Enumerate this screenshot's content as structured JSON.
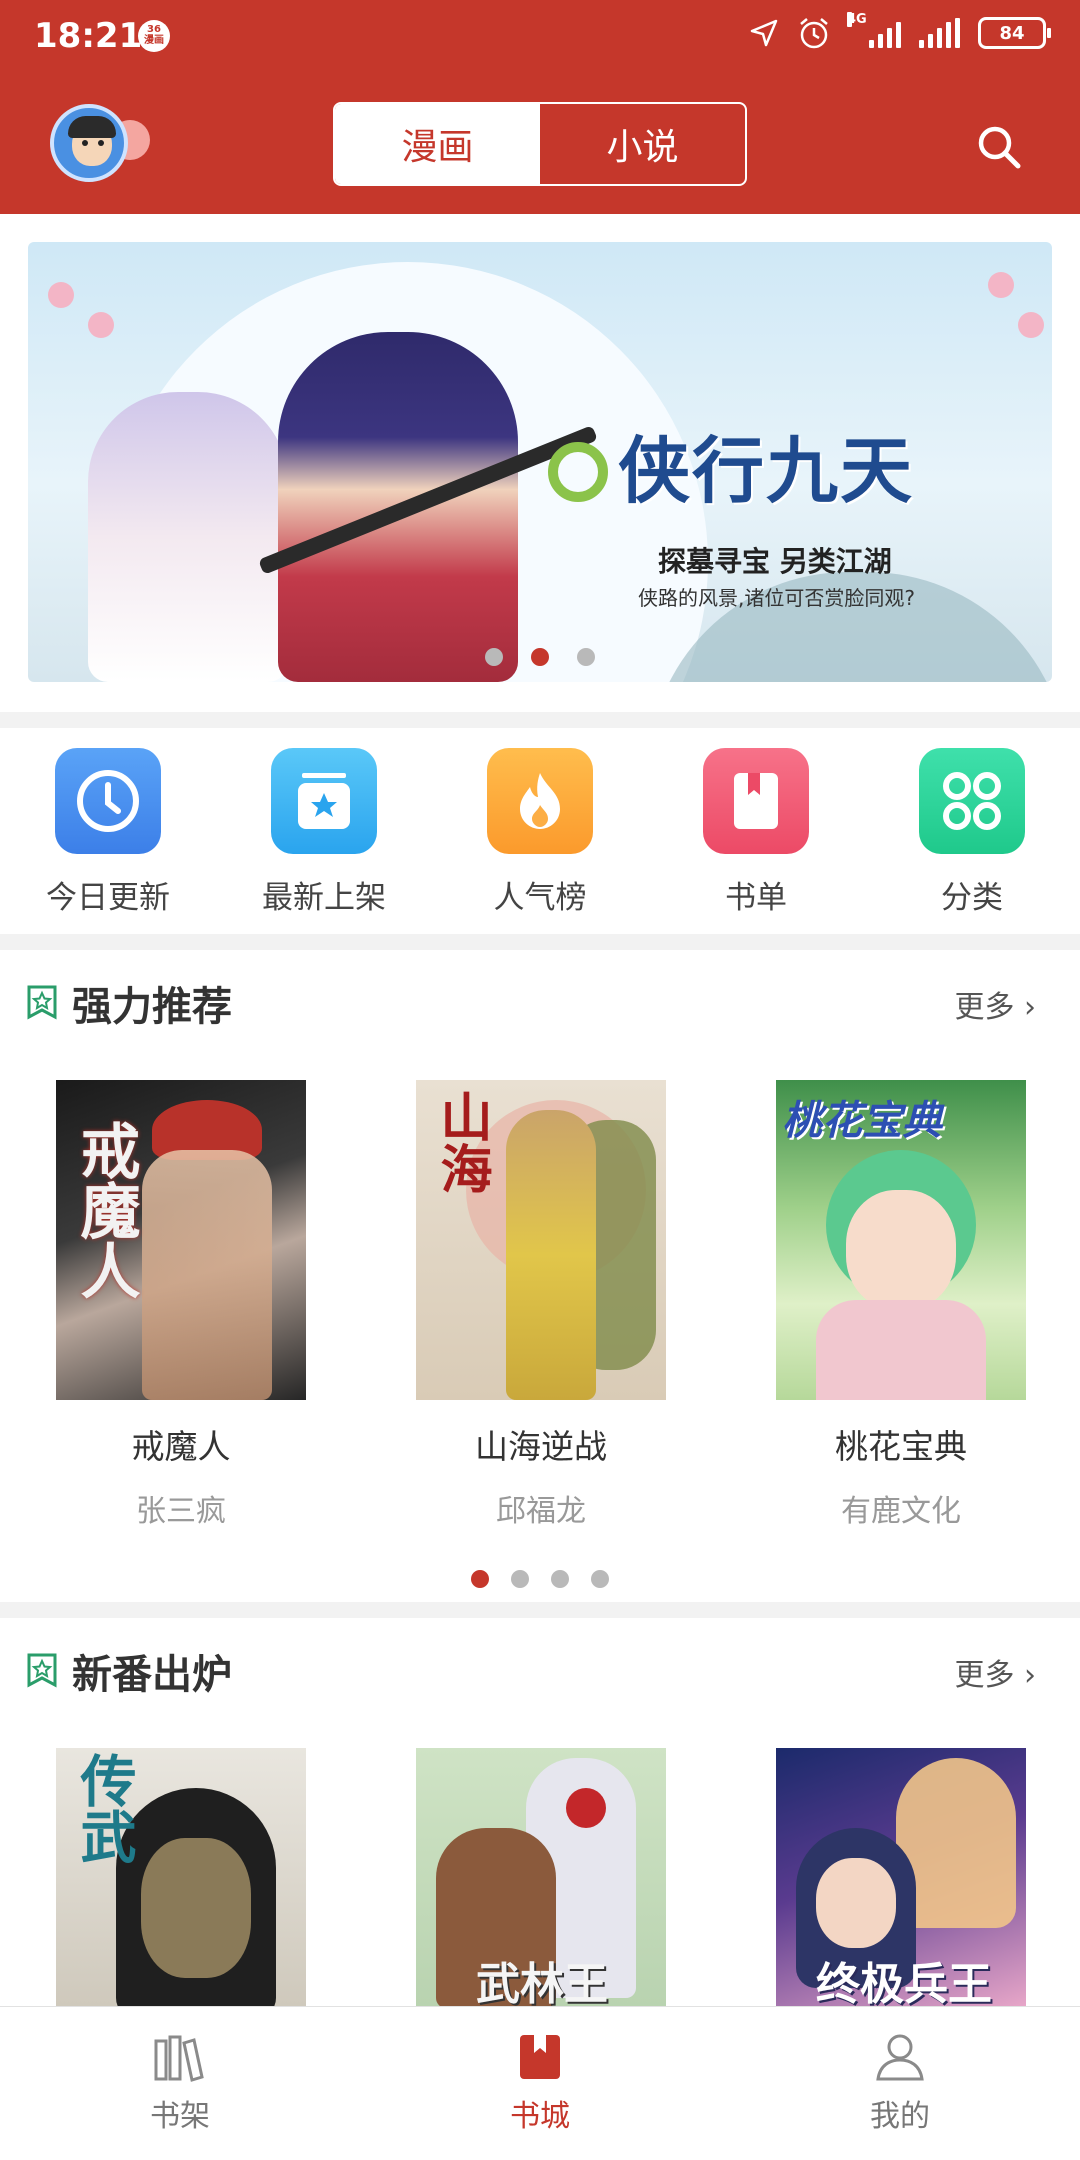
{
  "status_bar": {
    "time": "18:21",
    "app_badge": "36漫画",
    "network": "4G",
    "battery": "84"
  },
  "header": {
    "tabs": [
      {
        "label": "漫画",
        "active": true
      },
      {
        "label": "小说",
        "active": false
      }
    ],
    "accent": "#c5372b"
  },
  "banner": {
    "title": "侠行九天",
    "subtitle": "探墓寻宝 另类江湖",
    "tagline": "侠路的风景,诸位可否赏脸同观?",
    "dot_count": 3,
    "active_dot": 2
  },
  "entries": [
    {
      "label": "今日更新",
      "icon": "clock-icon",
      "color": "#4b8ff0"
    },
    {
      "label": "最新上架",
      "icon": "new-shelf-icon",
      "color": "#3fb6f0"
    },
    {
      "label": "人气榜",
      "icon": "flame-icon",
      "color": "#fda83a"
    },
    {
      "label": "书单",
      "icon": "book-list-icon",
      "color": "#f05b72"
    },
    {
      "label": "分类",
      "icon": "category-icon",
      "color": "#2fd59a"
    }
  ],
  "sections": {
    "recommend": {
      "title": "强力推荐",
      "more": "更多",
      "books": [
        {
          "name": "戒魔人",
          "author": "张三疯",
          "cover_text": "戒魔人"
        },
        {
          "name": "山海逆战",
          "author": "邱福龙",
          "cover_text": "山海"
        },
        {
          "name": "桃花宝典",
          "author": "有鹿文化",
          "cover_text": "桃花宝典"
        }
      ],
      "page_dots": 4,
      "active_page": 1
    },
    "new_release": {
      "title": "新番出炉",
      "more": "更多",
      "books": [
        {
          "cover_text": "传武"
        },
        {
          "cover_text": "武林王"
        },
        {
          "cover_text": "终极兵王"
        }
      ]
    }
  },
  "tabbar": [
    {
      "label": "书架",
      "icon": "bookshelf-icon",
      "active": false
    },
    {
      "label": "书城",
      "icon": "bookstore-icon",
      "active": true
    },
    {
      "label": "我的",
      "icon": "profile-icon",
      "active": false
    }
  ]
}
